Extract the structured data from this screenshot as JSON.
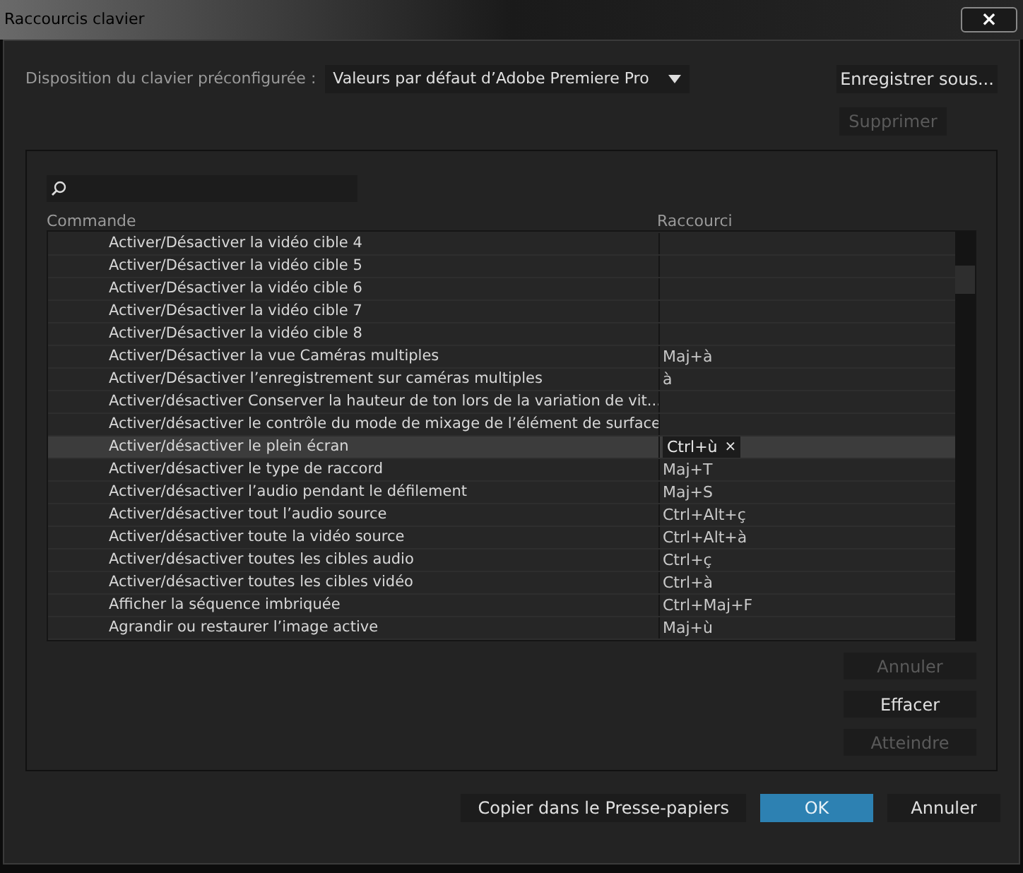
{
  "window": {
    "title": "Raccourcis clavier",
    "close": "×"
  },
  "preset": {
    "label": "Disposition du clavier préconfigurée :",
    "value": "Valeurs par défaut d’Adobe Premiere Pro"
  },
  "top_buttons": [
    {
      "label": "Enregistrer sous...",
      "disabled": false
    },
    {
      "label": "Supprimer",
      "disabled": true
    }
  ],
  "table": {
    "columns": [
      "Commande",
      "Raccourci"
    ],
    "rows": [
      {
        "command": "Activer/Désactiver la vidéo cible 4",
        "shortcut": "",
        "selected": false
      },
      {
        "command": "Activer/Désactiver la vidéo cible 5",
        "shortcut": "",
        "selected": false
      },
      {
        "command": "Activer/Désactiver la vidéo cible 6",
        "shortcut": "",
        "selected": false
      },
      {
        "command": "Activer/Désactiver la vidéo cible 7",
        "shortcut": "",
        "selected": false
      },
      {
        "command": "Activer/Désactiver la vidéo cible 8",
        "shortcut": "",
        "selected": false
      },
      {
        "command": "Activer/Désactiver la vue Caméras multiples",
        "shortcut": "Maj+à",
        "selected": false
      },
      {
        "command": "Activer/Désactiver l’enregistrement sur caméras multiples",
        "shortcut": "à",
        "selected": false
      },
      {
        "command": "Activer/désactiver Conserver la hauteur de ton lors de la variation de vit...",
        "shortcut": "",
        "selected": false
      },
      {
        "command": "Activer/désactiver le contrôle du mode de mixage de l’élément de surface",
        "shortcut": "",
        "selected": false
      },
      {
        "command": "Activer/désactiver le plein écran",
        "shortcut": "Ctrl+ù",
        "remove": "×",
        "selected": true
      },
      {
        "command": "Activer/désactiver le type de raccord",
        "shortcut": "Maj+T",
        "selected": false
      },
      {
        "command": "Activer/désactiver l’audio pendant le défilement",
        "shortcut": "Maj+S",
        "selected": false
      },
      {
        "command": "Activer/désactiver tout l’audio source",
        "shortcut": "Ctrl+Alt+ç",
        "selected": false
      },
      {
        "command": "Activer/désactiver toute la vidéo source",
        "shortcut": "Ctrl+Alt+à",
        "selected": false
      },
      {
        "command": "Activer/désactiver toutes les cibles audio",
        "shortcut": "Ctrl+ç",
        "selected": false
      },
      {
        "command": "Activer/désactiver toutes les cibles vidéo",
        "shortcut": "Ctrl+à",
        "selected": false
      },
      {
        "command": "Afficher la séquence imbriquée",
        "shortcut": "Ctrl+Maj+F",
        "selected": false
      },
      {
        "command": "Agrandir ou restaurer l’image active",
        "shortcut": "Maj+ù",
        "selected": false
      }
    ]
  },
  "side_buttons": [
    {
      "label": "Annuler",
      "disabled": true
    },
    {
      "label": "Effacer",
      "disabled": false
    },
    {
      "label": "Atteindre",
      "disabled": true
    }
  ],
  "footer_buttons": [
    {
      "label": "Copier dans le Presse-papiers",
      "primary": false
    },
    {
      "label": "OK",
      "primary": true
    },
    {
      "label": "Annuler",
      "primary": false
    }
  ]
}
